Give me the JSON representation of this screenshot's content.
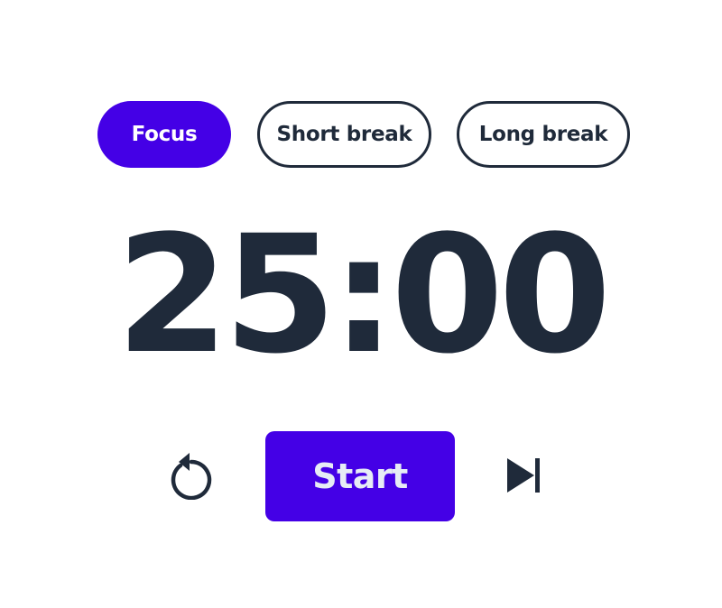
{
  "modes": {
    "focus_label": "Focus",
    "short_break_label": "Short break",
    "long_break_label": "Long break",
    "active": "focus"
  },
  "timer": {
    "display": "25:00"
  },
  "controls": {
    "reset_icon": "reset-icon",
    "start_label": "Start",
    "skip_icon": "skip-next-icon"
  },
  "colors": {
    "accent": "#4400e6",
    "text": "#1f2a3a",
    "start_text": "#e6ecf5",
    "background": "#ffffff"
  }
}
